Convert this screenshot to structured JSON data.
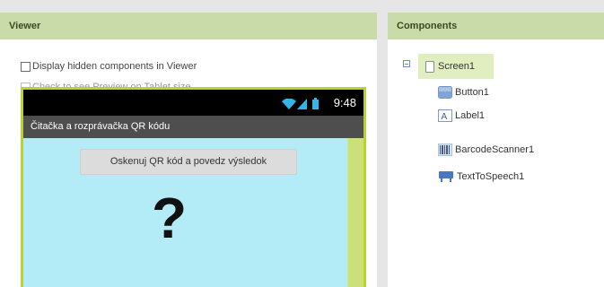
{
  "viewer": {
    "header": "Viewer",
    "display_hidden_label": "Display hidden components in Viewer",
    "tablet_preview_label": "Check to see Preview on Tablet size.",
    "phone": {
      "time": "9:48",
      "app_title": "Čitačka a rozprávačka QR kódu",
      "button_text": "Oskenuj QR kód a povedz výsledok",
      "image_text": "?"
    }
  },
  "components": {
    "header": "Components",
    "root": {
      "label": "Screen1",
      "icon": "screen-icon"
    },
    "items": [
      {
        "label": "Button1",
        "icon": "button-icon"
      },
      {
        "label": "Label1",
        "icon": "label-icon"
      },
      {
        "label": "BarcodeScanner1",
        "icon": "barcode-scanner-icon"
      },
      {
        "label": "TextToSpeech1",
        "icon": "text-to-speech-icon"
      }
    ]
  },
  "colors": {
    "header_bg": "#c9dba8",
    "phone_border": "#b9d233",
    "screen_bg": "#b3ecf6",
    "title_bar": "#4e4e4e",
    "status_bar": "#000000",
    "selection": "#e0eec0"
  }
}
